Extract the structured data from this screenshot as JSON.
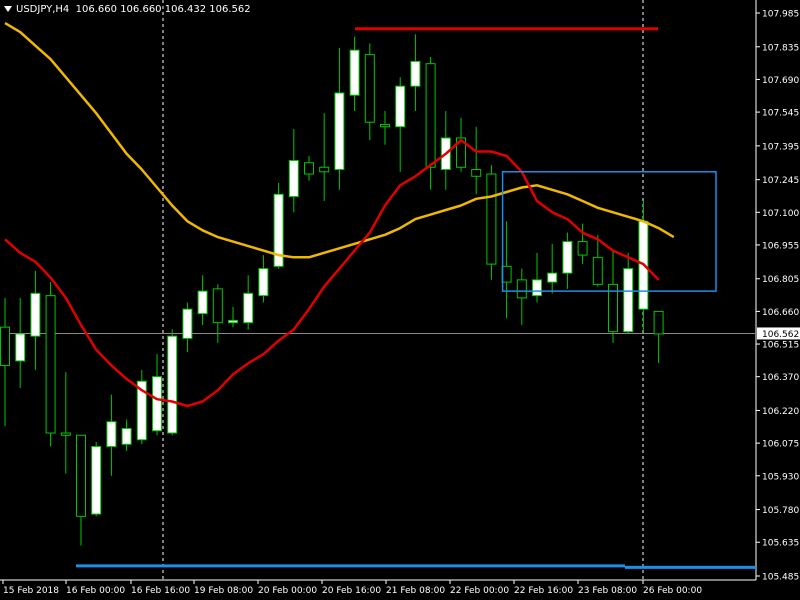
{
  "header": {
    "symbol_timeframe": "USDJPY,H4",
    "ohlc": "106.660 106.660 106.432 106.562"
  },
  "colors": {
    "background": "#000000",
    "axis": "#ffffff",
    "bull_candle": "#ffffff",
    "bear_candle": "#000000",
    "wick": "#00c800",
    "ma_fast": "#e00000",
    "ma_slow": "#f0b800",
    "hline_high": "#e00000",
    "hline_low": "#1e8ee6",
    "rectangle": "#1e8ee6",
    "current_price_tag": "#ffffff",
    "grid_vline": "#ffffff"
  },
  "chart_data": {
    "type": "candlestick",
    "symbol": "USDJPY",
    "timeframe": "H4",
    "x_labels": [
      "15 Feb 2018",
      "16 Feb 00:00",
      "16 Feb 16:00",
      "19 Feb 08:00",
      "20 Feb 00:00",
      "20 Feb 16:00",
      "21 Feb 08:00",
      "22 Feb 00:00",
      "22 Feb 16:00",
      "23 Feb 08:00",
      "26 Feb 00:00"
    ],
    "y_ticks": [
      "107.985",
      "107.835",
      "107.690",
      "107.545",
      "107.395",
      "107.245",
      "107.100",
      "106.955",
      "106.805",
      "106.660",
      "106.515",
      "106.370",
      "106.220",
      "106.075",
      "105.930",
      "105.780",
      "105.635",
      "105.485"
    ],
    "y_range": [
      105.45,
      108.01
    ],
    "current_price": "106.562",
    "candles": [
      {
        "o": 106.59,
        "h": 106.72,
        "l": 106.15,
        "c": 106.42
      },
      {
        "o": 106.44,
        "h": 106.72,
        "l": 106.32,
        "c": 106.56
      },
      {
        "o": 106.55,
        "h": 106.84,
        "l": 106.4,
        "c": 106.74
      },
      {
        "o": 106.73,
        "h": 106.79,
        "l": 106.06,
        "c": 106.12
      },
      {
        "o": 106.12,
        "h": 106.39,
        "l": 105.94,
        "c": 106.11
      },
      {
        "o": 106.11,
        "h": 106.11,
        "l": 105.62,
        "c": 105.75
      },
      {
        "o": 105.76,
        "h": 106.08,
        "l": 105.75,
        "c": 106.06
      },
      {
        "o": 106.06,
        "h": 106.29,
        "l": 105.93,
        "c": 106.17
      },
      {
        "o": 106.07,
        "h": 106.18,
        "l": 106.04,
        "c": 106.14
      },
      {
        "o": 106.09,
        "h": 106.4,
        "l": 106.07,
        "c": 106.35
      },
      {
        "o": 106.13,
        "h": 106.47,
        "l": 106.11,
        "c": 106.37
      },
      {
        "o": 106.12,
        "h": 106.58,
        "l": 106.11,
        "c": 106.55
      },
      {
        "o": 106.54,
        "h": 106.7,
        "l": 106.48,
        "c": 106.67
      },
      {
        "o": 106.65,
        "h": 106.82,
        "l": 106.6,
        "c": 106.75
      },
      {
        "o": 106.76,
        "h": 106.78,
        "l": 106.52,
        "c": 106.61
      },
      {
        "o": 106.61,
        "h": 106.68,
        "l": 106.59,
        "c": 106.62
      },
      {
        "o": 106.61,
        "h": 106.82,
        "l": 106.58,
        "c": 106.74
      },
      {
        "o": 106.73,
        "h": 106.91,
        "l": 106.7,
        "c": 106.85
      },
      {
        "o": 106.86,
        "h": 107.23,
        "l": 106.85,
        "c": 107.18
      },
      {
        "o": 107.17,
        "h": 107.47,
        "l": 107.1,
        "c": 107.33
      },
      {
        "o": 107.32,
        "h": 107.35,
        "l": 107.24,
        "c": 107.27
      },
      {
        "o": 107.3,
        "h": 107.54,
        "l": 107.15,
        "c": 107.28
      },
      {
        "o": 107.29,
        "h": 107.83,
        "l": 107.2,
        "c": 107.63
      },
      {
        "o": 107.62,
        "h": 107.88,
        "l": 107.55,
        "c": 107.82
      },
      {
        "o": 107.8,
        "h": 107.85,
        "l": 107.42,
        "c": 107.5
      },
      {
        "o": 107.49,
        "h": 107.55,
        "l": 107.4,
        "c": 107.48
      },
      {
        "o": 107.48,
        "h": 107.7,
        "l": 107.28,
        "c": 107.66
      },
      {
        "o": 107.66,
        "h": 107.89,
        "l": 107.55,
        "c": 107.77
      },
      {
        "o": 107.76,
        "h": 107.79,
        "l": 107.2,
        "c": 107.3
      },
      {
        "o": 107.29,
        "h": 107.55,
        "l": 107.2,
        "c": 107.43
      },
      {
        "o": 107.43,
        "h": 107.52,
        "l": 107.28,
        "c": 107.3
      },
      {
        "o": 107.29,
        "h": 107.48,
        "l": 107.18,
        "c": 107.26
      },
      {
        "o": 107.27,
        "h": 107.31,
        "l": 106.8,
        "c": 106.87
      },
      {
        "o": 106.86,
        "h": 107.06,
        "l": 106.63,
        "c": 106.79
      },
      {
        "o": 106.8,
        "h": 106.85,
        "l": 106.6,
        "c": 106.72
      },
      {
        "o": 106.73,
        "h": 106.92,
        "l": 106.7,
        "c": 106.8
      },
      {
        "o": 106.79,
        "h": 106.96,
        "l": 106.74,
        "c": 106.83
      },
      {
        "o": 106.83,
        "h": 107.01,
        "l": 106.76,
        "c": 106.97
      },
      {
        "o": 106.97,
        "h": 107.05,
        "l": 106.87,
        "c": 106.91
      },
      {
        "o": 106.9,
        "h": 107.0,
        "l": 106.77,
        "c": 106.78
      },
      {
        "o": 106.78,
        "h": 106.93,
        "l": 106.52,
        "c": 106.57
      },
      {
        "o": 106.57,
        "h": 106.92,
        "l": 106.56,
        "c": 106.85
      },
      {
        "o": 106.67,
        "h": 107.15,
        "l": 106.57,
        "c": 107.06
      },
      {
        "o": 106.66,
        "h": 106.66,
        "l": 106.43,
        "c": 106.56
      }
    ],
    "ma_fast": [
      106.98,
      106.92,
      106.88,
      106.81,
      106.72,
      106.6,
      106.49,
      106.42,
      106.36,
      106.31,
      106.27,
      106.26,
      106.24,
      106.26,
      106.31,
      106.38,
      106.43,
      106.47,
      106.53,
      106.58,
      106.67,
      106.77,
      106.85,
      106.93,
      107.01,
      107.13,
      107.22,
      107.26,
      107.31,
      107.36,
      107.42,
      107.37,
      107.37,
      107.35,
      107.28,
      107.15,
      107.1,
      107.07,
      107.01,
      106.98,
      106.93,
      106.9,
      106.87,
      106.8
    ],
    "ma_slow": [
      107.94,
      107.9,
      107.84,
      107.78,
      107.7,
      107.62,
      107.54,
      107.45,
      107.36,
      107.29,
      107.21,
      107.13,
      107.06,
      107.02,
      106.99,
      106.97,
      106.95,
      106.93,
      106.91,
      106.9,
      106.9,
      106.92,
      106.94,
      106.96,
      106.98,
      107.0,
      107.03,
      107.07,
      107.09,
      107.11,
      107.13,
      107.16,
      107.17,
      107.19,
      107.21,
      107.22,
      107.2,
      107.18,
      107.15,
      107.12,
      107.1,
      107.08,
      107.06,
      107.03,
      106.99
    ],
    "hline_high": 107.915,
    "hline_low": 105.53,
    "rectangle": {
      "start_index": 33,
      "end_index": 46,
      "top": 107.28,
      "bottom": 106.75
    }
  }
}
